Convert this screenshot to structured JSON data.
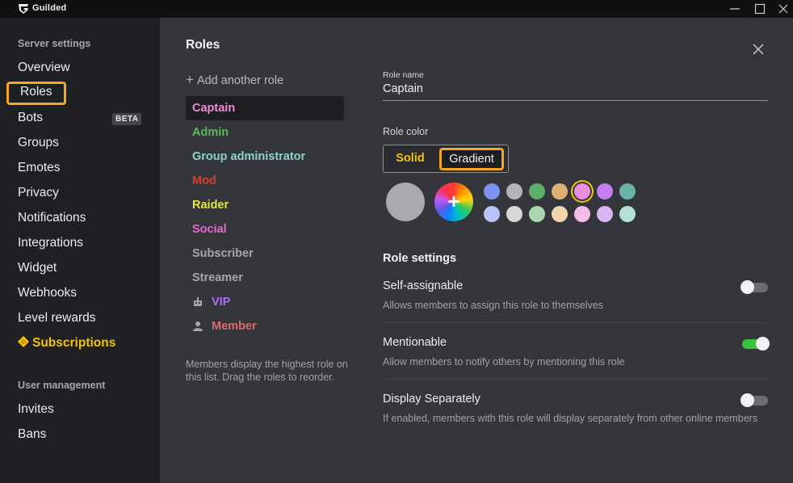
{
  "app": {
    "name": "Guilded"
  },
  "sidebar": {
    "server_section_title": "Server settings",
    "items": [
      {
        "label": "Overview"
      },
      {
        "label": "Roles"
      },
      {
        "label": "Bots",
        "badge": "BETA"
      },
      {
        "label": "Groups"
      },
      {
        "label": "Emotes"
      },
      {
        "label": "Privacy"
      },
      {
        "label": "Notifications"
      },
      {
        "label": "Integrations"
      },
      {
        "label": "Widget"
      },
      {
        "label": "Webhooks"
      },
      {
        "label": "Level rewards"
      },
      {
        "label": "Subscriptions"
      }
    ],
    "user_section_title": "User management",
    "user_items": [
      {
        "label": "Invites"
      },
      {
        "label": "Bans"
      }
    ]
  },
  "main": {
    "title": "Roles",
    "add_role_label": "Add another role",
    "roles": [
      {
        "name": "Captain",
        "color": "#f08ad6"
      },
      {
        "name": "Admin",
        "color": "#5cb85c"
      },
      {
        "name": "Group administrator",
        "color": "#8fd3c7"
      },
      {
        "name": "Mod",
        "color": "#d2402b"
      },
      {
        "name": "Raider",
        "color": "#e6e62d"
      },
      {
        "name": "Social",
        "color": "#e46ad1"
      },
      {
        "name": "Subscriber",
        "color": "#a5a7ab"
      },
      {
        "name": "Streamer",
        "color": "#a5a7ab"
      },
      {
        "name": "VIP",
        "color": "#a96ef5",
        "icon": "robot-icon"
      },
      {
        "name": "Member",
        "color": "#e06a6a",
        "icon": "user-icon"
      }
    ],
    "roles_note": "Members display the highest role on this list. Drag the roles to reorder.",
    "role_name_label": "Role name",
    "role_name_value": "Captain",
    "role_color_label": "Role color",
    "color_mode": {
      "solid": "Solid",
      "gradient": "Gradient",
      "selected": "Gradient"
    },
    "swatches_row1": [
      "#7c93f2",
      "#b4b4b4",
      "#5dad6b",
      "#e0b072",
      "#e98ee0",
      "#c47ef0",
      "#69b4a6"
    ],
    "swatches_row2": [
      "#b8c3fa",
      "#d8d8d8",
      "#a9d6ad",
      "#f3d6ad",
      "#f4bde9",
      "#dbb4f6",
      "#b5e0d6"
    ],
    "selected_swatch": "#e98ee0",
    "role_settings_title": "Role settings",
    "settings": [
      {
        "title": "Self-assignable",
        "desc": "Allows members to assign this role to themselves",
        "on": false
      },
      {
        "title": "Mentionable",
        "desc": "Allow members to notify others by mentioning this role",
        "on": true
      },
      {
        "title": "Display Separately",
        "desc": "If enabled, members with this role will display separately from other online members",
        "on": false
      }
    ],
    "accent_colors": {
      "highlight": "#f5a623",
      "gold": "#f5c400",
      "toggle_on": "#39c33d"
    }
  }
}
